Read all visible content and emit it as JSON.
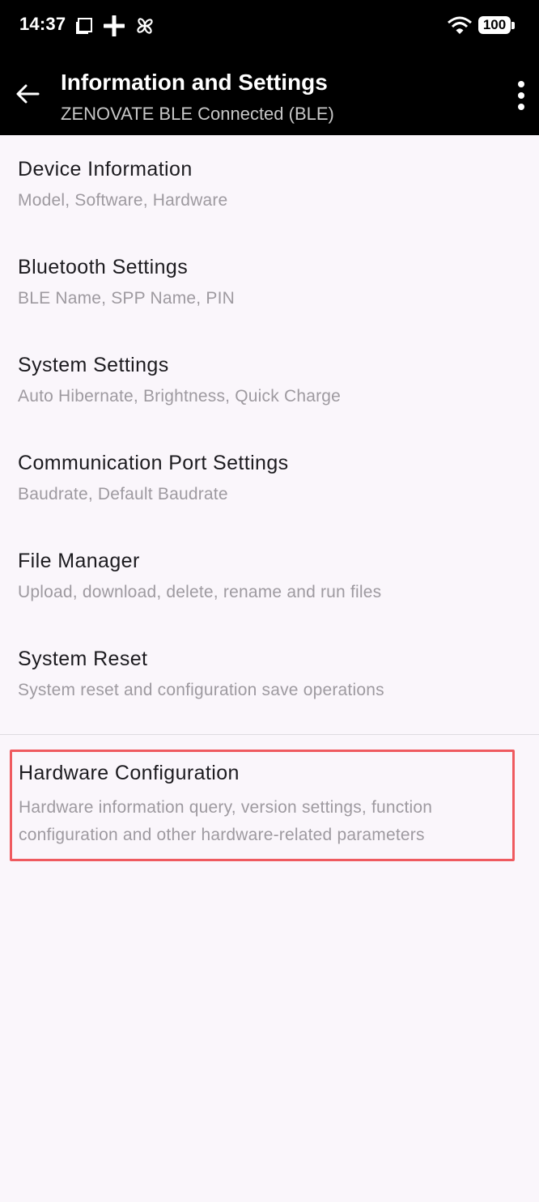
{
  "status_bar": {
    "time": "14:37",
    "battery": "100",
    "icons": [
      "notification-square-icon",
      "plus-icon",
      "pinwheel-icon",
      "wifi-icon",
      "battery-icon"
    ]
  },
  "app_bar": {
    "title": "Information and Settings",
    "subtitle": "ZENOVATE BLE Connected (BLE)",
    "back_icon": "arrow-left-icon",
    "menu_icon": "more-vertical-icon"
  },
  "settings": {
    "items": [
      {
        "title": "Device Information",
        "subtitle": "Model, Software, Hardware"
      },
      {
        "title": "Bluetooth Settings",
        "subtitle": "BLE Name, SPP Name, PIN"
      },
      {
        "title": "System Settings",
        "subtitle": "Auto Hibernate, Brightness, Quick Charge"
      },
      {
        "title": "Communication Port Settings",
        "subtitle": "Baudrate, Default Baudrate"
      },
      {
        "title": "File Manager",
        "subtitle": "Upload, download, delete, rename and run files"
      },
      {
        "title": "System Reset",
        "subtitle": "System reset and configuration save operations"
      }
    ],
    "hardware": {
      "title": "Hardware Configuration",
      "subtitle": "Hardware information query, version settings, function configuration and other hardware-related parameters"
    }
  },
  "colors": {
    "background": "#faf6fb",
    "header": "#000000",
    "title_text": "#1c1b1f",
    "subtitle_text": "#9e9aa0",
    "highlight_border": "#ef5a5f"
  }
}
